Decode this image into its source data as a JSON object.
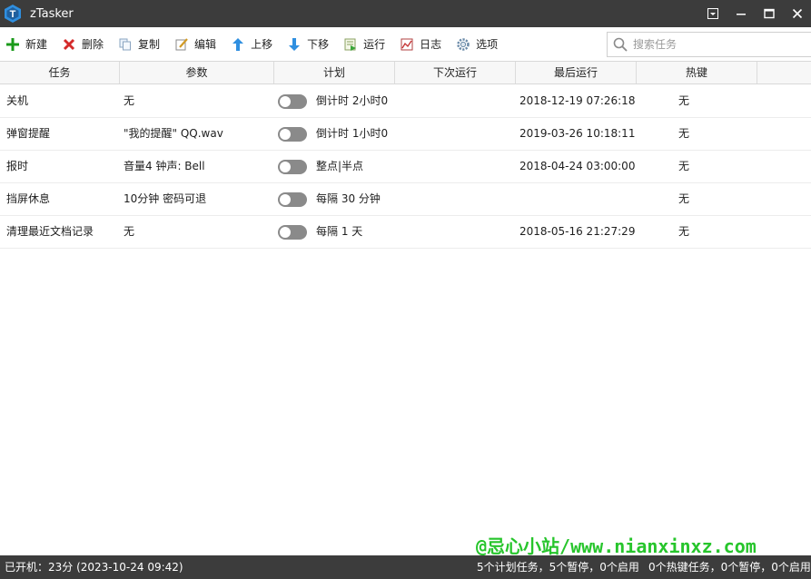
{
  "window": {
    "title": "zTasker",
    "logo_letter": "T"
  },
  "toolbar": {
    "buttons": [
      {
        "label": "新建",
        "icon": "plus-icon"
      },
      {
        "label": "删除",
        "icon": "delete-x-icon"
      },
      {
        "label": "复制",
        "icon": "copy-icon"
      },
      {
        "label": "编辑",
        "icon": "edit-icon"
      },
      {
        "label": "上移",
        "icon": "arrow-up-icon"
      },
      {
        "label": "下移",
        "icon": "arrow-down-icon"
      },
      {
        "label": "运行",
        "icon": "run-icon"
      },
      {
        "label": "日志",
        "icon": "log-icon"
      },
      {
        "label": "选项",
        "icon": "gear-icon"
      }
    ],
    "search_placeholder": "搜索任务"
  },
  "table": {
    "columns": [
      "任务",
      "参数",
      "计划",
      "下次运行",
      "最后运行",
      "热键"
    ],
    "rows": [
      {
        "task": "关机",
        "param": "无",
        "enabled": false,
        "plan": "倒计时 2小时0",
        "next_run": "",
        "last_run": "2018-12-19 07:26:18",
        "hotkey": "无"
      },
      {
        "task": "弹窗提醒",
        "param": "\"我的提醒\" QQ.wav",
        "enabled": false,
        "plan": "倒计时 1小时0",
        "next_run": "",
        "last_run": "2019-03-26 10:18:11",
        "hotkey": "无"
      },
      {
        "task": "报时",
        "param": "音量4 钟声: Bell",
        "enabled": false,
        "plan": "整点|半点",
        "next_run": "",
        "last_run": "2018-04-24 03:00:00",
        "hotkey": "无"
      },
      {
        "task": "挡屏休息",
        "param": "10分钟 密码可退",
        "enabled": false,
        "plan": "每隔 30 分钟",
        "next_run": "",
        "last_run": "",
        "hotkey": "无"
      },
      {
        "task": "清理最近文档记录",
        "param": "无",
        "enabled": false,
        "plan": "每隔 1 天",
        "next_run": "",
        "last_run": "2018-05-16 21:27:29",
        "hotkey": "无"
      }
    ]
  },
  "watermark": "@忌心小站/www.nianxinxz.com",
  "statusbar": {
    "uptime": "已开机：23分 (2023-10-24 09:42)",
    "plan_tasks": "5个计划任务，5个暂停，0个启用",
    "hotkey_tasks": "0个热键任务，0个暂停，0个启用"
  },
  "colors": {
    "titlebar_bg": "#3c3c3c",
    "toggle_off": "#8a8a8a",
    "watermark": "#27c52c",
    "logo_blue": "#2f8fe0"
  }
}
